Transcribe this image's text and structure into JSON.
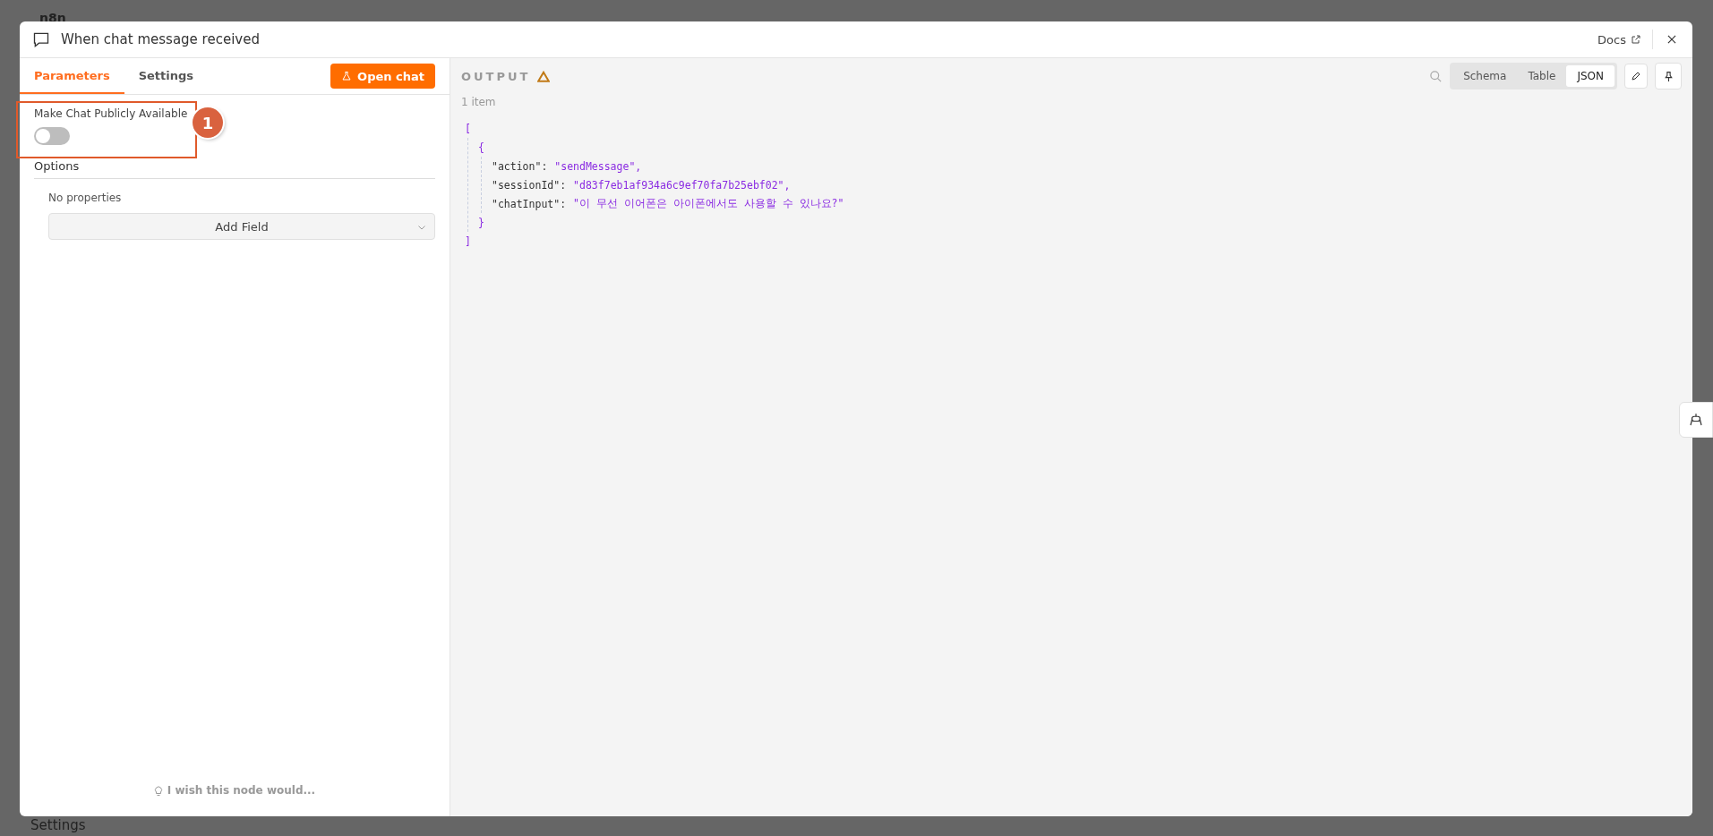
{
  "background": {
    "logo": "n8n",
    "sidebar_bottom": "Settings"
  },
  "modal": {
    "title": "When chat message received",
    "docs_link": "Docs"
  },
  "tabs": [
    {
      "label": "Parameters",
      "selected": true
    },
    {
      "label": "Settings",
      "selected": false
    }
  ],
  "open_chat_button": "Open chat",
  "toggle": {
    "label": "Make Chat Publicly Available",
    "on": false
  },
  "annotation": {
    "number": "1"
  },
  "options": {
    "title": "Options",
    "empty_text": "No properties",
    "add_field": "Add Field"
  },
  "feedback_link": "I wish this node would...",
  "output": {
    "title": "OUTPUT",
    "count": "1 item",
    "views": [
      {
        "label": "Schema",
        "selected": false
      },
      {
        "label": "Table",
        "selected": false
      },
      {
        "label": "JSON",
        "selected": true
      }
    ],
    "json": {
      "open": "[",
      "close": "]",
      "items": [
        {
          "open": "{",
          "close": "}",
          "fields": [
            {
              "key": "\"action\":",
              "value": "\"sendMessage\","
            },
            {
              "key": "\"sessionId\":",
              "value": "\"d83f7eb1af934a6c9ef70fa7b25ebf02\","
            },
            {
              "key": "\"chatInput\":",
              "value": "\"이 무선 이어폰은 아이폰에서도 사용할 수 있나요?\""
            }
          ]
        }
      ]
    }
  }
}
